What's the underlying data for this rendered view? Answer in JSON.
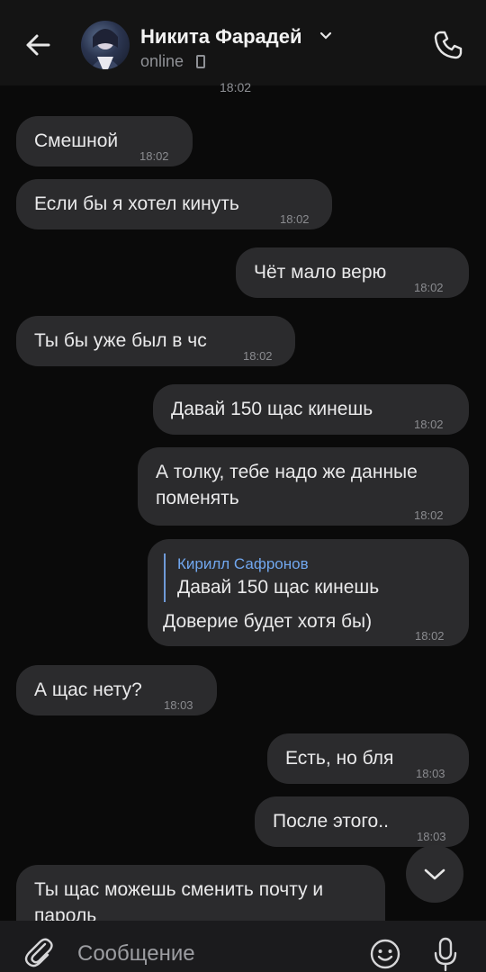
{
  "header": {
    "contact_name": "Никита Фарадей",
    "status": "online",
    "top_peek_time": "18:02"
  },
  "messages": [
    {
      "side": "in",
      "text": "Смешной",
      "time": "18:02"
    },
    {
      "side": "in",
      "text": "Если бы я хотел кинуть",
      "time": "18:02"
    },
    {
      "side": "out",
      "text": "Чёт мало верю",
      "time": "18:02"
    },
    {
      "side": "in",
      "text": "Ты бы уже был в чс",
      "time": "18:02"
    },
    {
      "side": "out",
      "text": "Давай 150 щас кинешь",
      "time": "18:02"
    },
    {
      "side": "out",
      "lines": [
        "А толку, тебе надо же данные",
        "поменять"
      ],
      "time": "18:02"
    },
    {
      "side": "out",
      "reply": {
        "author": "Кирилл Сафронов",
        "text": "Давай 150 щас кинешь"
      },
      "text": "Доверие будет хотя бы)",
      "time": "18:02"
    },
    {
      "side": "in",
      "text": "А щас нету?",
      "time": "18:03"
    },
    {
      "side": "out",
      "text": "Есть, но бля",
      "time": "18:03"
    },
    {
      "side": "out",
      "text": "После этого..",
      "time": "18:03"
    },
    {
      "side": "in",
      "lines": [
        "Ты щас можешь сменить почту и",
        "пароль"
      ],
      "time": ""
    }
  ],
  "composer": {
    "placeholder": "Сообщение"
  },
  "icons": {
    "back": "arrow-left-icon",
    "call": "phone-icon",
    "attach": "paperclip-icon",
    "emoji": "smile-icon",
    "mic": "microphone-icon",
    "scroll": "chevron-down-icon"
  },
  "colors": {
    "background": "#0a0a0a",
    "bubble": "#2b2b2d",
    "reply_accent": "#71a7ef"
  }
}
